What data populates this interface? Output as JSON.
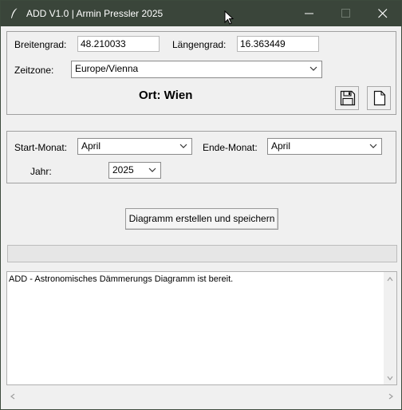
{
  "window": {
    "title": "ADD V1.0 | Armin Pressler 2025",
    "icon": "feather-icon",
    "controls": [
      "minimize-icon",
      "maximize-icon",
      "close-icon"
    ]
  },
  "location": {
    "latitude_label": "Breitengrad:",
    "latitude_value": "48.210033",
    "longitude_label": "Längengrad:",
    "longitude_value": "16.363449",
    "timezone_label": "Zeitzone:",
    "timezone_value": "Europe/Vienna",
    "place_text": "Ort: Wien",
    "save_icon": "floppy-disk-icon",
    "new_file_icon": "document-icon"
  },
  "period": {
    "start_label": "Start-Monat:",
    "start_value": "April",
    "end_label": "Ende-Monat:",
    "end_value": "April",
    "year_label": "Jahr:",
    "year_value": "2025"
  },
  "actions": {
    "create_button_label": "Diagramm erstellen und speichern"
  },
  "progress": {
    "value": 0
  },
  "log": {
    "text": "ADD - Astronomisches Dämmerungs Diagramm ist bereit."
  },
  "colors": {
    "titlebar": "#3a453a",
    "window_bg": "#f0f0f0"
  }
}
